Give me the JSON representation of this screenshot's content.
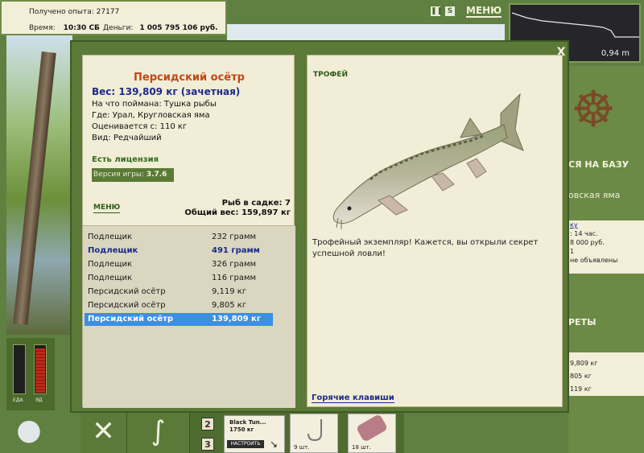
{
  "topbar": {
    "experience_label": "Получено опыта:",
    "experience_value": "27177",
    "time_label": "Время:",
    "time_value": "10:30 СБ",
    "money_label": "Деньги:",
    "money_value": "1 005 795 106 руб."
  },
  "top_controls": {
    "pause_icon": "pause-icon",
    "s_label": "S",
    "menu_label": "МЕНЮ"
  },
  "minimap": {
    "depth": "0,94 m"
  },
  "right_panel": {
    "base_heading": "СЯ НА БАЗУ",
    "location_partial": "овская яма",
    "info_lines": [
      "ку",
      ": 14 час.",
      "8 000 руб.",
      "1",
      "не объявлены"
    ],
    "records_heading": "РЕТЫ",
    "records": [
      "9,809 кг",
      "805 кг",
      "119 кг"
    ]
  },
  "meters": {
    "food_label": "ЕДА",
    "fish_label": "ЯД"
  },
  "bottom_bar": {
    "slot_numbers": [
      "2",
      "3"
    ],
    "lure_name": "Black Tun...",
    "lure_weight": "1750 кг",
    "setup_button": "НАСТРОИТЬ",
    "item_counts": [
      "9 шт.",
      "18 шт."
    ]
  },
  "modal": {
    "close_label": "X",
    "fish_name": "Персидский осётр",
    "weight_line": "Вес: 139,809 кг (зачетная)",
    "caught_on": "На что поймана: Тушка рыбы",
    "location": "Где: Урал, Кругловская яма",
    "rated_from": "Оценивается с: 110 кг",
    "species_type": "Вид: Редчайший",
    "license": "Есть лицензия",
    "version_label": "Версия игры:",
    "version_value": "3.7.6",
    "menu_label": "МЕНЮ",
    "keep_count": "Рыб в садке: 7",
    "total_weight": "Общий вес: 159,897 кг",
    "catch_list": [
      {
        "name": "Подлещик",
        "weight": "232 грамм",
        "style": "normal"
      },
      {
        "name": "Подлещик",
        "weight": "491 грамм",
        "style": "bold"
      },
      {
        "name": "Подлещик",
        "weight": "326 грамм",
        "style": "normal"
      },
      {
        "name": "Подлещик",
        "weight": "116 грамм",
        "style": "normal"
      },
      {
        "name": "Персидский осётр",
        "weight": "9,119 кг",
        "style": "normal"
      },
      {
        "name": "Персидский осётр",
        "weight": "9,805 кг",
        "style": "normal"
      },
      {
        "name": "Персидский осётр",
        "weight": "139,809 кг",
        "style": "selected"
      }
    ],
    "trophy_label": "ТРОФЕЙ",
    "trophy_text": "Трофейный экземпляр! Кажется, вы открыли секрет успешной ловли!",
    "hotkeys_label": "Горячие клавиши"
  }
}
